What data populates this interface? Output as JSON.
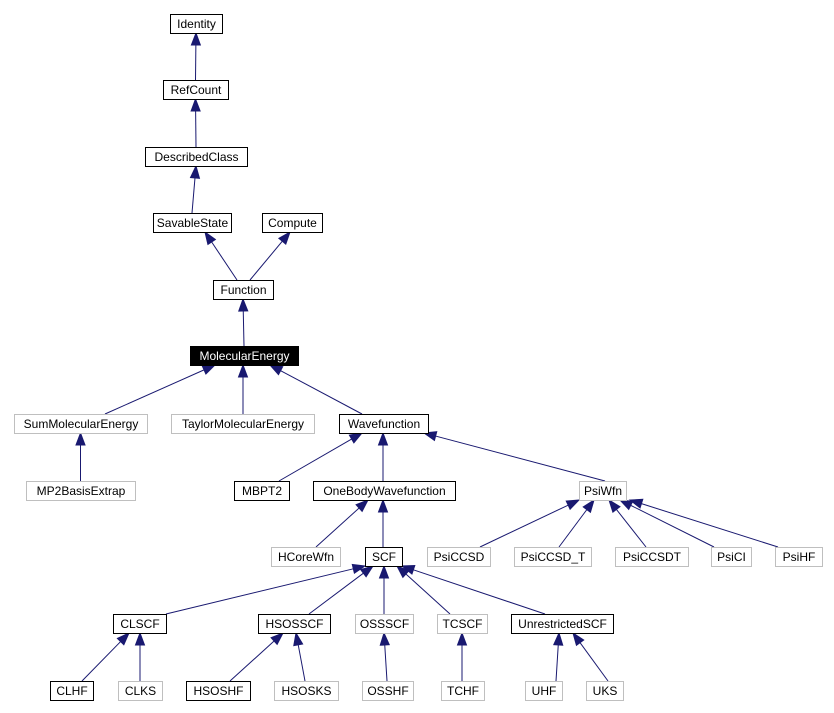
{
  "diagram": {
    "type": "class-inheritance-graph",
    "colors": {
      "edge": "#191970",
      "documented_border": "#000000",
      "undocumented_border": "#bfbfbf",
      "highlight_fill": "#000000",
      "highlight_text": "#ffffff",
      "text": "#000000"
    },
    "nodes": [
      {
        "id": "Identity",
        "label": "Identity",
        "style": "normal"
      },
      {
        "id": "RefCount",
        "label": "RefCount",
        "style": "normal"
      },
      {
        "id": "DescribedClass",
        "label": "DescribedClass",
        "style": "normal"
      },
      {
        "id": "SavableState",
        "label": "SavableState",
        "style": "normal"
      },
      {
        "id": "Compute",
        "label": "Compute",
        "style": "normal"
      },
      {
        "id": "Function",
        "label": "Function",
        "style": "normal"
      },
      {
        "id": "MolecularEnergy",
        "label": "MolecularEnergy",
        "style": "highlight"
      },
      {
        "id": "SumMolecularEnergy",
        "label": "SumMolecularEnergy",
        "style": "gray"
      },
      {
        "id": "TaylorMolecularEnergy",
        "label": "TaylorMolecularEnergy",
        "style": "gray"
      },
      {
        "id": "Wavefunction",
        "label": "Wavefunction",
        "style": "normal"
      },
      {
        "id": "MP2BasisExtrap",
        "label": "MP2BasisExtrap",
        "style": "gray"
      },
      {
        "id": "MBPT2",
        "label": "MBPT2",
        "style": "normal"
      },
      {
        "id": "OneBodyWavefunction",
        "label": "OneBodyWavefunction",
        "style": "normal"
      },
      {
        "id": "PsiWfn",
        "label": "PsiWfn",
        "style": "gray"
      },
      {
        "id": "HCoreWfn",
        "label": "HCoreWfn",
        "style": "gray"
      },
      {
        "id": "SCF",
        "label": "SCF",
        "style": "normal"
      },
      {
        "id": "PsiCCSD",
        "label": "PsiCCSD",
        "style": "gray"
      },
      {
        "id": "PsiCCSD_T",
        "label": "PsiCCSD_T",
        "style": "gray"
      },
      {
        "id": "PsiCCSDT",
        "label": "PsiCCSDT",
        "style": "gray"
      },
      {
        "id": "PsiCI",
        "label": "PsiCI",
        "style": "gray"
      },
      {
        "id": "PsiHF",
        "label": "PsiHF",
        "style": "gray"
      },
      {
        "id": "CLSCF",
        "label": "CLSCF",
        "style": "normal"
      },
      {
        "id": "HSOSSCF",
        "label": "HSOSSCF",
        "style": "normal"
      },
      {
        "id": "OSSSCF",
        "label": "OSSSCF",
        "style": "gray"
      },
      {
        "id": "TCSCF",
        "label": "TCSCF",
        "style": "gray"
      },
      {
        "id": "UnrestrictedSCF",
        "label": "UnrestrictedSCF",
        "style": "normal"
      },
      {
        "id": "CLHF",
        "label": "CLHF",
        "style": "normal"
      },
      {
        "id": "CLKS",
        "label": "CLKS",
        "style": "gray"
      },
      {
        "id": "HSOSHF",
        "label": "HSOSHF",
        "style": "normal"
      },
      {
        "id": "HSOSKS",
        "label": "HSOSKS",
        "style": "gray"
      },
      {
        "id": "OSSHF",
        "label": "OSSHF",
        "style": "gray"
      },
      {
        "id": "TCHF",
        "label": "TCHF",
        "style": "gray"
      },
      {
        "id": "UHF",
        "label": "UHF",
        "style": "gray"
      },
      {
        "id": "UKS",
        "label": "UKS",
        "style": "gray"
      }
    ],
    "edges": [
      {
        "from": "RefCount",
        "to": "Identity"
      },
      {
        "from": "DescribedClass",
        "to": "RefCount"
      },
      {
        "from": "SavableState",
        "to": "DescribedClass"
      },
      {
        "from": "Function",
        "to": "SavableState"
      },
      {
        "from": "Function",
        "to": "Compute"
      },
      {
        "from": "MolecularEnergy",
        "to": "Function"
      },
      {
        "from": "SumMolecularEnergy",
        "to": "MolecularEnergy"
      },
      {
        "from": "TaylorMolecularEnergy",
        "to": "MolecularEnergy"
      },
      {
        "from": "Wavefunction",
        "to": "MolecularEnergy"
      },
      {
        "from": "MP2BasisExtrap",
        "to": "SumMolecularEnergy"
      },
      {
        "from": "MBPT2",
        "to": "Wavefunction"
      },
      {
        "from": "OneBodyWavefunction",
        "to": "Wavefunction"
      },
      {
        "from": "PsiWfn",
        "to": "Wavefunction"
      },
      {
        "from": "HCoreWfn",
        "to": "OneBodyWavefunction"
      },
      {
        "from": "SCF",
        "to": "OneBodyWavefunction"
      },
      {
        "from": "PsiCCSD",
        "to": "PsiWfn"
      },
      {
        "from": "PsiCCSD_T",
        "to": "PsiWfn"
      },
      {
        "from": "PsiCCSDT",
        "to": "PsiWfn"
      },
      {
        "from": "PsiCI",
        "to": "PsiWfn"
      },
      {
        "from": "PsiHF",
        "to": "PsiWfn"
      },
      {
        "from": "CLSCF",
        "to": "SCF"
      },
      {
        "from": "HSOSSCF",
        "to": "SCF"
      },
      {
        "from": "OSSSCF",
        "to": "SCF"
      },
      {
        "from": "TCSCF",
        "to": "SCF"
      },
      {
        "from": "UnrestrictedSCF",
        "to": "SCF"
      },
      {
        "from": "CLHF",
        "to": "CLSCF"
      },
      {
        "from": "CLKS",
        "to": "CLSCF"
      },
      {
        "from": "HSOSHF",
        "to": "HSOSSCF"
      },
      {
        "from": "HSOSKS",
        "to": "HSOSSCF"
      },
      {
        "from": "OSSHF",
        "to": "OSSSCF"
      },
      {
        "from": "TCHF",
        "to": "TCSCF"
      },
      {
        "from": "UHF",
        "to": "UnrestrictedSCF"
      },
      {
        "from": "UKS",
        "to": "UnrestrictedSCF"
      }
    ]
  }
}
